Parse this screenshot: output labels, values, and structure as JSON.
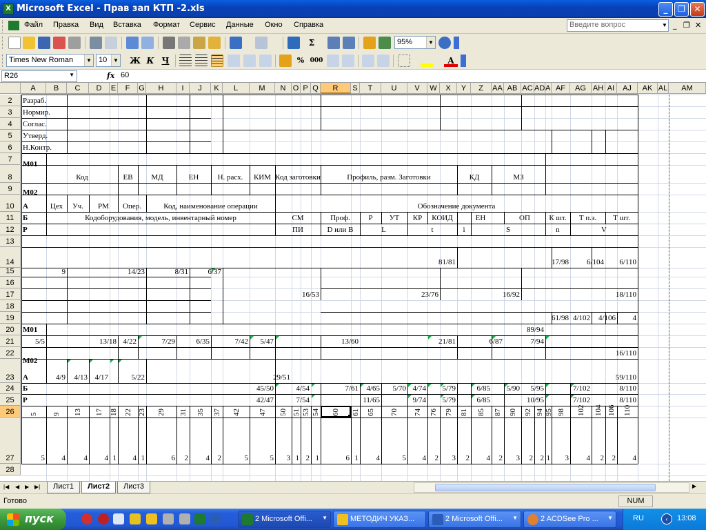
{
  "window": {
    "title": "Microsoft Excel - Прав зап КТП -2.xls",
    "icon": "excel-icon"
  },
  "menu": {
    "items": [
      "Файл",
      "Правка",
      "Вид",
      "Вставка",
      "Формат",
      "Сервис",
      "Данные",
      "Окно",
      "Справка"
    ],
    "ask_placeholder": "Введите вопрос"
  },
  "toolbar": {
    "zoom": "95%",
    "font": "Times New Roman",
    "size": "10",
    "bold": "Ж",
    "italic": "К",
    "underline": "Ч",
    "currency": "%",
    "thousands": "000"
  },
  "formula_bar": {
    "name_box": "R26",
    "fx": "fx",
    "value": "60"
  },
  "grid": {
    "columns": [
      "A",
      "B",
      "C",
      "D",
      "E",
      "F",
      "G",
      "H",
      "I",
      "J",
      "K",
      "L",
      "M",
      "N",
      "O",
      "P",
      "Q",
      "R",
      "S",
      "T",
      "U",
      "V",
      "W",
      "X",
      "Y",
      "Z",
      "AA",
      "AB",
      "AC",
      "AD",
      "AE",
      "AF",
      "AG",
      "AH",
      "AI",
      "AJ",
      "AK",
      "AL",
      "AM"
    ],
    "selected_column": "R",
    "selected_row": "26",
    "rows": [
      "1",
      "2",
      "3",
      "4",
      "5",
      "6",
      "7",
      "8",
      "9",
      "10",
      "11",
      "12",
      "13",
      "14",
      "15",
      "16",
      "17",
      "18",
      "19",
      "20",
      "21",
      "22",
      "23",
      "24",
      "25",
      "26",
      "27",
      "28"
    ],
    "labels": {
      "razrab": "Разраб.",
      "normir": "Нормир.",
      "soglas": "Соглас.",
      "utverd": "Утверд.",
      "nkontr": "Н.Контр.",
      "m01": "М01",
      "m02": "М02",
      "kod": "Код",
      "ev": "ЕВ",
      "md": "МД",
      "en": "ЕН",
      "nrasch": "Н. расх.",
      "kim": "КИМ",
      "kod_zag": "Код заготовки",
      "profil": "Профиль, разм. Заготовки",
      "kd": "КД",
      "mz": "МЗ",
      "a": "А",
      "ceh": "Цех",
      "uch": "Уч.",
      "rm": "РМ",
      "oper": "Опер.",
      "kod_naim": "Код, наименование операции",
      "oboz": "Обозначение документа",
      "b": "Б",
      "kodob": "Кодоборудования, модель, инвентарный номер",
      "sm": "СМ",
      "prof": "Проф.",
      "r": "Р",
      "ut": "УТ",
      "kr": "КР",
      "koid": "КОИД",
      "en2": "ЕН",
      "op": "ОП",
      "ksht": "К шт.",
      "tpz": "Т п.з.",
      "tsht": "Т шт.",
      "p": "Р",
      "pi": "ПИ",
      "dilib": "D или B",
      "l": "L",
      "t": "t",
      "i": "i",
      "s": "S",
      "n": "n",
      "v": "V",
      "a23": "А",
      "b24": "Б",
      "p25": "Р",
      "m01b": "М01",
      "m02b": "М02"
    },
    "refs": {
      "r14_1": "81/81",
      "r14_2": "17/98",
      "r14_3": "6/104",
      "r14_4": "6/110",
      "r15_1": "9",
      "r15_2": "14/23",
      "r15_3": "8/31",
      "r15_4": "6/37",
      "r17_1": "16/53",
      "r17_2": "23/76",
      "r17_3": "16/92",
      "r17_4": "18/110",
      "r19_1": "61/98",
      "r19_2": "4/102",
      "r19_3": "4/106",
      "r19_4": "4",
      "r20_1": "89/94",
      "r21": [
        "5/5",
        "13/18",
        "4/22",
        "7/29",
        "6/35",
        "7/42",
        "5/47",
        "13/60",
        "21/81",
        "6/87",
        "7/94"
      ],
      "r22_1": "16/110",
      "r23": [
        "4/9",
        "4/13",
        "4/17",
        "5/22",
        "29/51",
        "59/110"
      ],
      "r24": [
        "45/50",
        "4/54",
        "7/61",
        "4/65",
        "5/70",
        "4/74",
        "5/79",
        "6/85",
        "5/90",
        "5/95",
        "7/102",
        "8/110"
      ],
      "r25": [
        "42/47",
        "7/54",
        "11/65",
        "9/74",
        "5/79",
        "6/85",
        "10/95",
        "7/102",
        "8/110"
      ]
    },
    "row26": [
      "5",
      "9",
      "13",
      "17",
      "18",
      "22",
      "23",
      "29",
      "31",
      "35",
      "37",
      "42",
      "47",
      "50",
      "51",
      "53",
      "54",
      "60",
      "61",
      "65",
      "70",
      "74",
      "76",
      "79",
      "81",
      "85",
      "87",
      "90",
      "92",
      "94",
      "95",
      "98",
      "102",
      "104",
      "106",
      "110"
    ],
    "row27": [
      "5",
      "4",
      "4",
      "4",
      "1",
      "4",
      "1",
      "6",
      "2",
      "4",
      "2",
      "5",
      "5",
      "3",
      "1",
      "2",
      "1",
      "6",
      "1",
      "4",
      "5",
      "4",
      "2",
      "3",
      "2",
      "4",
      "2",
      "3",
      "2",
      "2",
      "1",
      "3",
      "4",
      "2",
      "2",
      "4"
    ]
  },
  "sheets": {
    "tabs": [
      "Лист1",
      "Лист2",
      "Лист3"
    ],
    "active": "Лист2"
  },
  "status": {
    "ready": "Готово",
    "num": "NUM"
  },
  "taskbar": {
    "start": "пуск",
    "tasks": [
      "2 Microsoft Offi...",
      "МЕТОДИЧ УКАЗ...",
      "2 Microsoft Offi...",
      "2 ACDSee Pro ..."
    ],
    "lang": "RU",
    "clock": "13:08"
  }
}
